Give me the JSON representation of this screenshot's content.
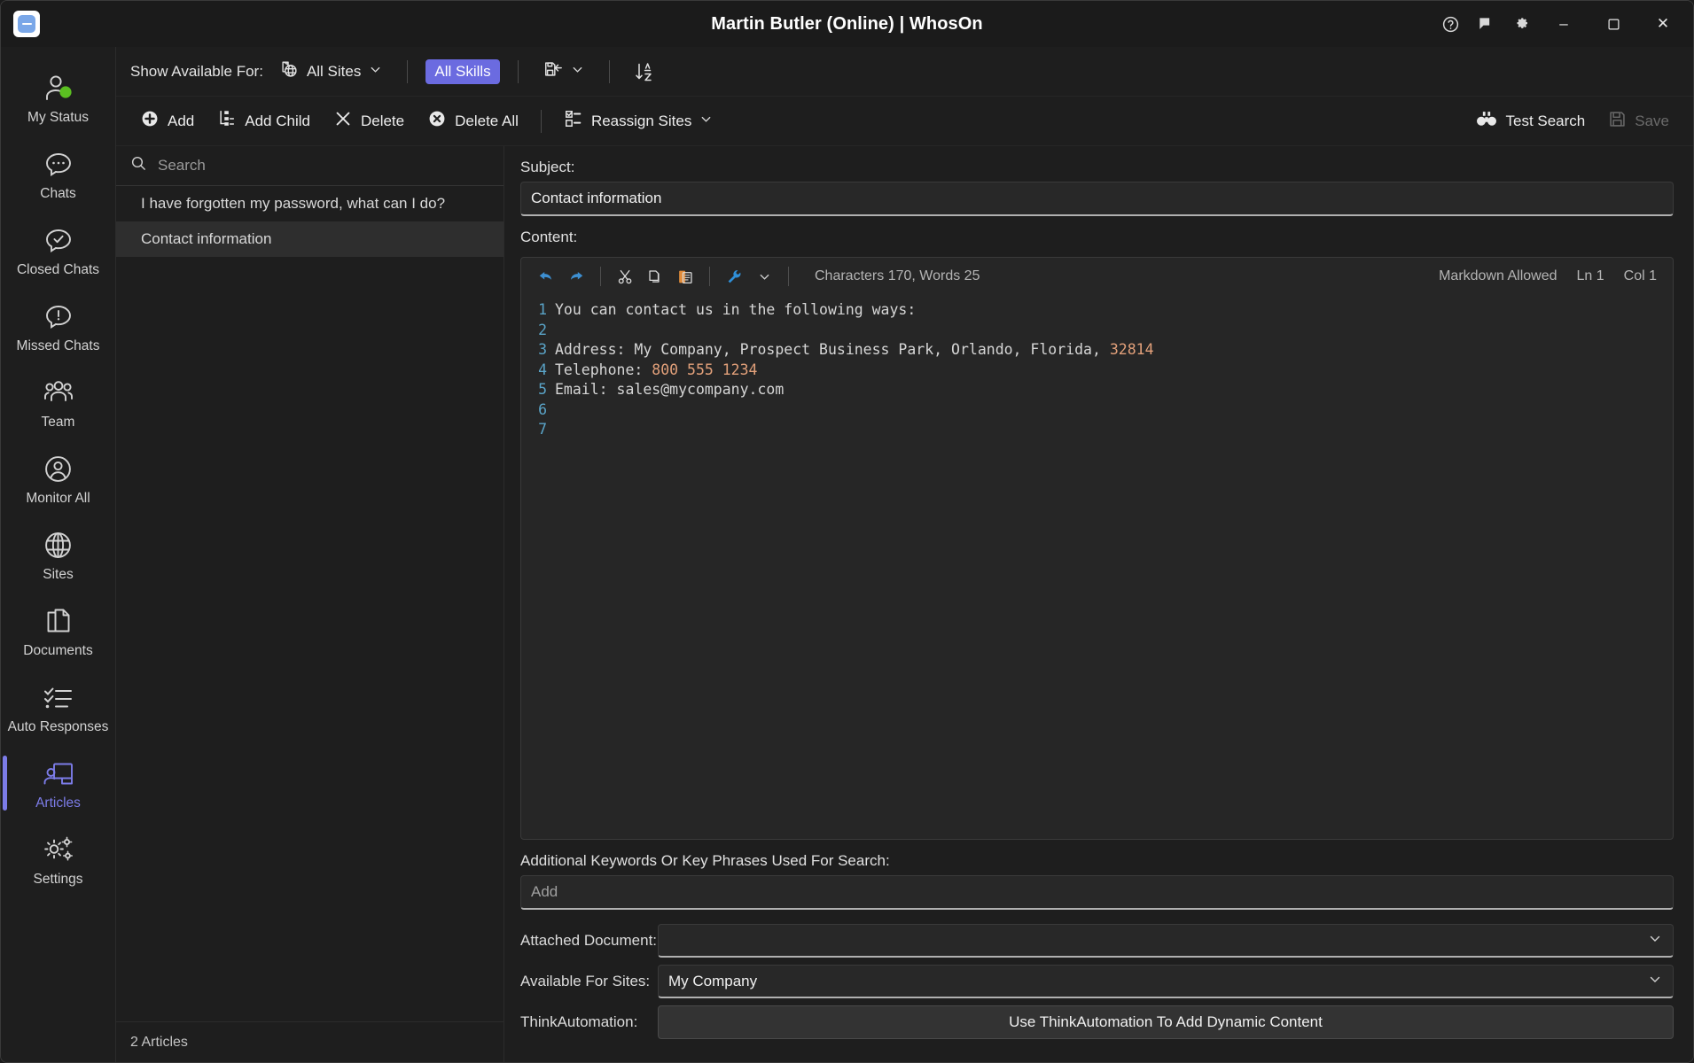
{
  "titlebar": {
    "title": "Martin Butler (Online)  | WhosOn",
    "logo_icon": "whoson-logo-icon",
    "help_icon": "help-circle-icon",
    "feedback_icon": "feedback-flag-icon",
    "settings_icon": "gear-icon",
    "minimize_label": "–",
    "maximize_label": "❑",
    "close_label": "✕"
  },
  "sidebar": {
    "items": [
      {
        "label": "My Status",
        "icon": "user-status-icon",
        "active": false
      },
      {
        "label": "Chats",
        "icon": "chat-bubble-icon",
        "active": false
      },
      {
        "label": "Closed Chats",
        "icon": "chat-check-icon",
        "active": false
      },
      {
        "label": "Missed Chats",
        "icon": "chat-alert-icon",
        "active": false
      },
      {
        "label": "Team",
        "icon": "team-group-icon",
        "active": false
      },
      {
        "label": "Monitor All",
        "icon": "user-circle-icon",
        "active": false
      },
      {
        "label": "Sites",
        "icon": "globe-icon",
        "active": false
      },
      {
        "label": "Documents",
        "icon": "documents-copy-icon",
        "active": false
      },
      {
        "label": "Auto Responses",
        "icon": "checklist-icon",
        "active": false
      },
      {
        "label": "Articles",
        "icon": "articles-icon",
        "active": true
      },
      {
        "label": "Settings",
        "icon": "gears-icon",
        "active": false
      }
    ]
  },
  "filterbar": {
    "show_available_for_label": "Show Available For:",
    "sites_value": "All Sites",
    "sites_icon": "sites-globe-icon",
    "skills_pill": "All Skills",
    "skills_pill_color": "#6b6be0",
    "save_filter_icon": "save-filter-icon",
    "sort_icon": "sort-az-icon"
  },
  "actionbar": {
    "add_label": "Add",
    "add_icon": "plus-circle-icon",
    "add_child_label": "Add Child",
    "add_child_icon": "add-child-tree-icon",
    "delete_label": "Delete",
    "delete_icon": "x-icon",
    "delete_all_label": "Delete All",
    "delete_all_icon": "x-circle-icon",
    "reassign_label": "Reassign Sites",
    "reassign_icon": "reassign-checklist-icon",
    "test_search_label": "Test Search",
    "test_search_icon": "binoculars-icon",
    "save_label": "Save",
    "save_icon": "floppy-save-icon",
    "save_disabled": true
  },
  "list": {
    "search_placeholder": "Search",
    "search_value": "",
    "search_icon": "search-icon",
    "items": [
      {
        "label": "I have forgotten my password, what can I do?",
        "selected": false
      },
      {
        "label": "Contact information",
        "selected": true
      }
    ],
    "footer": "2 Articles"
  },
  "detail": {
    "subject_label": "Subject:",
    "subject_value": "Contact information",
    "content_label": "Content:",
    "editor": {
      "undo_icon": "undo-arrow-icon",
      "redo_icon": "redo-arrow-icon",
      "cut_icon": "scissors-icon",
      "copy_icon": "copy-icon",
      "paste_icon": "paste-clipboard-icon",
      "tools_icon": "wrench-icon",
      "tools_chevron_icon": "chevron-down-icon",
      "char_word_status": "Characters 170, Words 25",
      "markdown_status": "Markdown Allowed",
      "line_status": "Ln 1",
      "col_status": "Col 1",
      "lines": [
        {
          "n": "1",
          "parts": [
            {
              "t": "You can contact us in the following ways:",
              "c": "plain"
            }
          ]
        },
        {
          "n": "2",
          "parts": [
            {
              "t": "",
              "c": "plain"
            }
          ]
        },
        {
          "n": "3",
          "parts": [
            {
              "t": "Address: My Company, Prospect Business Park, Orlando, Florida, ",
              "c": "plain"
            },
            {
              "t": "32814",
              "c": "num"
            }
          ]
        },
        {
          "n": "4",
          "parts": [
            {
              "t": "Telephone: ",
              "c": "plain"
            },
            {
              "t": "800 555 1234",
              "c": "num"
            }
          ]
        },
        {
          "n": "5",
          "parts": [
            {
              "t": "Email: sales@mycompany.com",
              "c": "plain"
            }
          ]
        },
        {
          "n": "6",
          "parts": [
            {
              "t": "",
              "c": "plain"
            }
          ]
        },
        {
          "n": "7",
          "parts": [
            {
              "t": "",
              "c": "plain"
            }
          ]
        }
      ]
    },
    "keywords_label": "Additional Keywords Or Key Phrases Used For Search:",
    "keywords_placeholder": "Add",
    "keywords_value": "",
    "attached_document_label": "Attached Document:",
    "attached_document_value": "",
    "available_for_sites_label": "Available For Sites:",
    "available_for_sites_value": "My Company",
    "thinkautomation_label": "ThinkAutomation:",
    "thinkautomation_button": "Use ThinkAutomation To Add Dynamic Content"
  }
}
